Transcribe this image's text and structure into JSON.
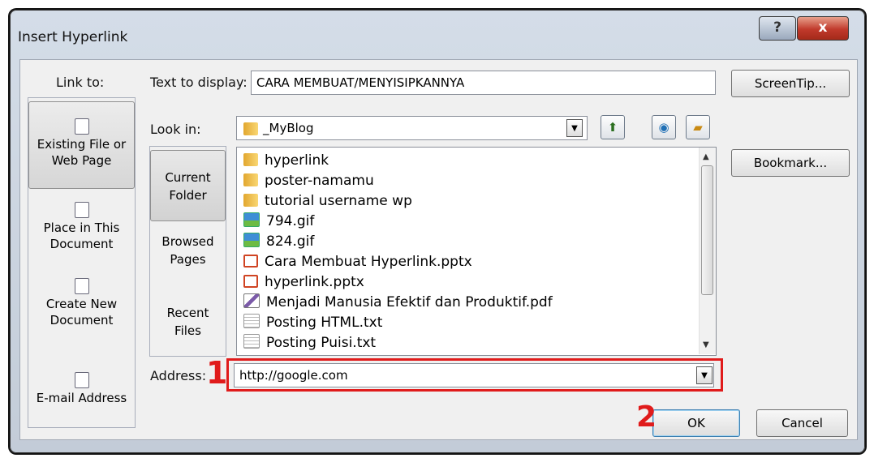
{
  "window": {
    "title": "Insert Hyperlink",
    "help_label": "?",
    "close_label": "x"
  },
  "link_to": {
    "label": "Link to:",
    "items": [
      {
        "label": "Existing File or Web Page",
        "icon": "web-page-icon",
        "selected": true
      },
      {
        "label": "Place in This Document",
        "icon": "document-place-icon",
        "selected": false
      },
      {
        "label": "Create New Document",
        "icon": "new-document-icon",
        "selected": false
      },
      {
        "label": "E-mail Address",
        "icon": "email-icon",
        "selected": false
      }
    ]
  },
  "text_to_display": {
    "label": "Text to display:",
    "value": "CARA MEMBUAT/MENYISIPKANNYA"
  },
  "screentip_label": "ScreenTip...",
  "bookmark_label": "Bookmark...",
  "look_in": {
    "label": "Look in:",
    "value": "_MyBlog"
  },
  "places": [
    {
      "label": "Current Folder",
      "selected": true
    },
    {
      "label": "Browsed Pages",
      "selected": false
    },
    {
      "label": "Recent Files",
      "selected": false
    }
  ],
  "files": [
    {
      "name": "hyperlink",
      "type": "folder"
    },
    {
      "name": "poster-namamu",
      "type": "folder"
    },
    {
      "name": "tutorial username wp",
      "type": "folder"
    },
    {
      "name": "794.gif",
      "type": "gif"
    },
    {
      "name": "824.gif",
      "type": "gif"
    },
    {
      "name": "Cara Membuat Hyperlink.pptx",
      "type": "pptx"
    },
    {
      "name": "hyperlink.pptx",
      "type": "pptx"
    },
    {
      "name": "Menjadi Manusia Efektif dan Produktif.pdf",
      "type": "pdf"
    },
    {
      "name": "Posting HTML.txt",
      "type": "txt"
    },
    {
      "name": "Posting Puisi.txt",
      "type": "txt"
    }
  ],
  "address": {
    "label": "Address:",
    "value": "http://google.com"
  },
  "ok_label": "OK",
  "cancel_label": "Cancel",
  "annotations": {
    "step1": "1",
    "step2": "2",
    "color": "#e01b1b"
  }
}
